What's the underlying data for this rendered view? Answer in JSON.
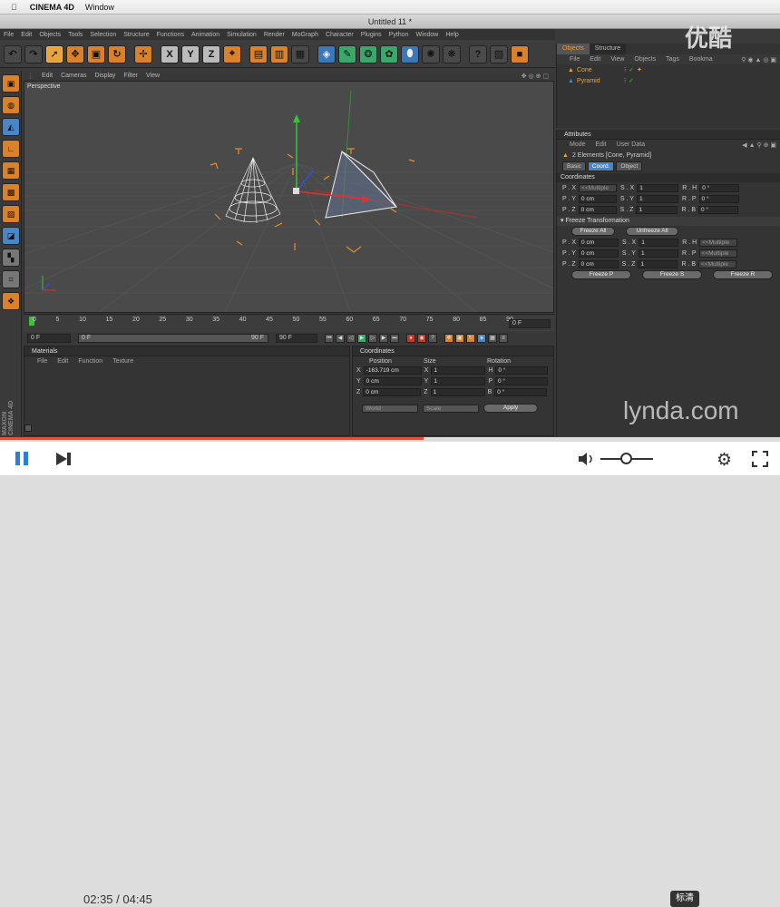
{
  "macbar": {
    "app": "CINEMA 4D",
    "menu": "Window"
  },
  "window_title": "Untitled 11 *",
  "watermark_top": "优酷",
  "watermark_brand": "lynda.com",
  "menubar": [
    "File",
    "Edit",
    "Objects",
    "Tools",
    "Selection",
    "Structure",
    "Functions",
    "Animation",
    "Simulation",
    "Render",
    "MoGraph",
    "Character",
    "Plugins",
    "Python",
    "Window",
    "Help"
  ],
  "toolbar": {
    "xyz": [
      "X",
      "Y",
      "Z"
    ]
  },
  "viewport": {
    "menu": [
      "Edit",
      "Cameras",
      "Display",
      "Filter",
      "View"
    ],
    "label": "Perspective"
  },
  "timeline": {
    "ticks": [
      "0",
      "5",
      "10",
      "15",
      "20",
      "25",
      "30",
      "35",
      "40",
      "45",
      "50",
      "55",
      "60",
      "65",
      "70",
      "75",
      "80",
      "85",
      "90"
    ],
    "current_frame": "0 F",
    "start_field": "0 F",
    "range_start": "0 F",
    "range_end": "90 F",
    "end_field": "90 F"
  },
  "materials": {
    "title": "Materials",
    "menu": [
      "File",
      "Edit",
      "Function",
      "Texture"
    ]
  },
  "coordinates": {
    "title": "Coordinates",
    "headers": [
      "Position",
      "Size",
      "Rotation"
    ],
    "rows": [
      {
        "axis": "X",
        "pos": "-163.719 cm",
        "size_axis": "X",
        "size": "1",
        "rot_axis": "H",
        "rot": "0 °"
      },
      {
        "axis": "Y",
        "pos": "0 cm",
        "size_axis": "Y",
        "size": "1",
        "rot_axis": "P",
        "rot": "0 °"
      },
      {
        "axis": "Z",
        "pos": "0 cm",
        "size_axis": "Z",
        "size": "1",
        "rot_axis": "B",
        "rot": "0 °"
      }
    ],
    "world": "World",
    "scale": "Scale",
    "apply": "Apply"
  },
  "objects": {
    "tabs": [
      "Objects",
      "Structure"
    ],
    "menu": [
      "File",
      "Edit",
      "View",
      "Objects",
      "Tags",
      "Bookma"
    ],
    "items": [
      {
        "name": "Cone",
        "color": "#e8a33a"
      },
      {
        "name": "Pyramid",
        "color": "#e8a33a"
      }
    ]
  },
  "attributes": {
    "title": "Attributes",
    "menu": [
      "Mode",
      "Edit",
      "User Data"
    ],
    "selection": "2 Elements [Cone, Pyramid]",
    "tabs": [
      "Basic",
      "Coord.",
      "Object"
    ],
    "section_coords": "Coordinates",
    "pos_rows": [
      {
        "p": "P . X",
        "pv": "<<Multiple",
        "s": "S . X",
        "sv": "1",
        "r": "R . H",
        "rv": "0 °"
      },
      {
        "p": "P . Y",
        "pv": "0 cm",
        "s": "S . Y",
        "sv": "1",
        "r": "R . P",
        "rv": "0 °"
      },
      {
        "p": "P . Z",
        "pv": "0 cm",
        "s": "S . Z",
        "sv": "1",
        "r": "R . B",
        "rv": "0 °"
      }
    ],
    "freeze_title": "Freeze Transformation",
    "freeze_all": "Freeze All",
    "unfreeze_all": "Unfreeze All",
    "freeze_rows": [
      {
        "p": "P . X",
        "pv": "0 cm",
        "s": "S . X",
        "sv": "1",
        "r": "R . H",
        "rv": "<<Multiple"
      },
      {
        "p": "P . Y",
        "pv": "0 cm",
        "s": "S . Y",
        "sv": "1",
        "r": "R . P",
        "rv": "<<Multiple"
      },
      {
        "p": "P . Z",
        "pv": "0 cm",
        "s": "S . Z",
        "sv": "1",
        "r": "R . B",
        "rv": "<<Multiple"
      }
    ],
    "freeze_p": "Freeze P",
    "freeze_s": "Freeze S",
    "freeze_r": "Freeze R"
  },
  "player": {
    "time": "02:35 / 04:45",
    "progress": 0.543,
    "quality": "标清"
  }
}
